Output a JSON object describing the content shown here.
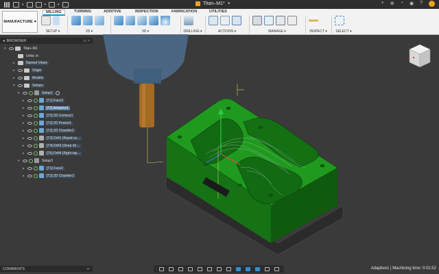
{
  "window": {
    "title": "Titan–M1*"
  },
  "ribbon": {
    "workspace_label": "MANUFACTURE",
    "tabs": [
      {
        "label": "MILLING",
        "active": true
      },
      {
        "label": "TURNING",
        "active": false
      },
      {
        "label": "ADDITIVE",
        "active": false
      },
      {
        "label": "INSPECTION",
        "active": false
      },
      {
        "label": "FABRICATION",
        "active": false
      },
      {
        "label": "UTILITIES",
        "active": false
      }
    ],
    "groups": [
      {
        "label": "SETUP ▾"
      },
      {
        "label": "2D ▾"
      },
      {
        "label": "3D ▾"
      },
      {
        "label": "DRILLING ▾"
      },
      {
        "label": "ACTIONS ▾"
      },
      {
        "label": "MANAGE ▾"
      },
      {
        "label": "INSPECT ▾"
      },
      {
        "label": "SELECT ▾"
      }
    ]
  },
  "browser": {
    "header": "BROWSER",
    "tree": [
      {
        "label": "Titan–M1"
      },
      {
        "label": "Units: in"
      },
      {
        "label": "Named Views"
      },
      {
        "label": "Origin"
      },
      {
        "label": "Models"
      },
      {
        "label": "Setups"
      },
      {
        "label": "Setup1"
      },
      {
        "label": "[T1] Face3"
      },
      {
        "label": "[T2] Adaptive1"
      },
      {
        "label": "[T2] 2D Contour1"
      },
      {
        "label": "[T2] 2D Pocket1"
      },
      {
        "label": "[T2] 2D Chamfer2"
      },
      {
        "label": "[T3] Drill1 (Rapid ou…"
      },
      {
        "label": "[T4] Drill3 (Deep dri…"
      },
      {
        "label": "[T5] Drill4 (Right tap…"
      },
      {
        "label": "Setup3"
      },
      {
        "label": "[T1] Face2"
      },
      {
        "label": "[T2] 2D Chamfer3"
      }
    ]
  },
  "comments": {
    "label": "COMMENTS",
    "add": "+"
  },
  "status": {
    "text": "Adaptive1 | Machining time: 0:01:52"
  },
  "colors": {
    "part_green": "#1f9a1f",
    "part_green_dark": "#0f5a0f",
    "ribbon_bg": "#f2f2f2",
    "accent_blue": "#0696d7",
    "viewport_bg": "#3a3a3a"
  }
}
